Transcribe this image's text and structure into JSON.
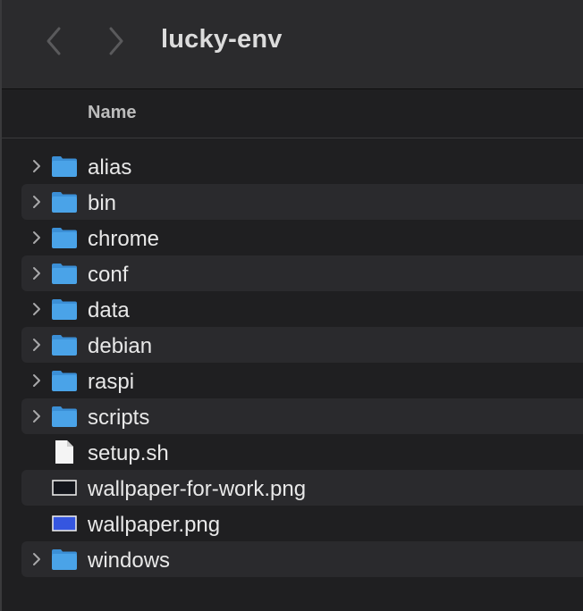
{
  "window": {
    "title": "lucky-env"
  },
  "toolbar": {
    "back_icon": "chevron-left-icon",
    "forward_icon": "chevron-right-icon"
  },
  "columns": {
    "name": "Name"
  },
  "colors": {
    "folder": "#4aa3e8",
    "folder_tab": "#3b8fd6",
    "alt_row": "#2a2a2d",
    "toolbar": "#2b2b2d",
    "background": "#1f1f21"
  },
  "files": [
    {
      "name": "alias",
      "kind": "folder",
      "icon": "folder-icon"
    },
    {
      "name": "bin",
      "kind": "folder",
      "icon": "folder-icon"
    },
    {
      "name": "chrome",
      "kind": "folder",
      "icon": "folder-icon"
    },
    {
      "name": "conf",
      "kind": "folder",
      "icon": "folder-icon"
    },
    {
      "name": "data",
      "kind": "folder",
      "icon": "folder-icon"
    },
    {
      "name": "debian",
      "kind": "folder",
      "icon": "folder-icon"
    },
    {
      "name": "raspi",
      "kind": "folder",
      "icon": "folder-icon"
    },
    {
      "name": "scripts",
      "kind": "folder",
      "icon": "folder-icon"
    },
    {
      "name": "setup.sh",
      "kind": "document",
      "icon": "document-icon"
    },
    {
      "name": "wallpaper-for-work.png",
      "kind": "image-dark",
      "icon": "image-thumbnail-icon"
    },
    {
      "name": "wallpaper.png",
      "kind": "image-blue",
      "icon": "image-thumbnail-icon"
    },
    {
      "name": "windows",
      "kind": "folder",
      "icon": "folder-icon"
    }
  ]
}
